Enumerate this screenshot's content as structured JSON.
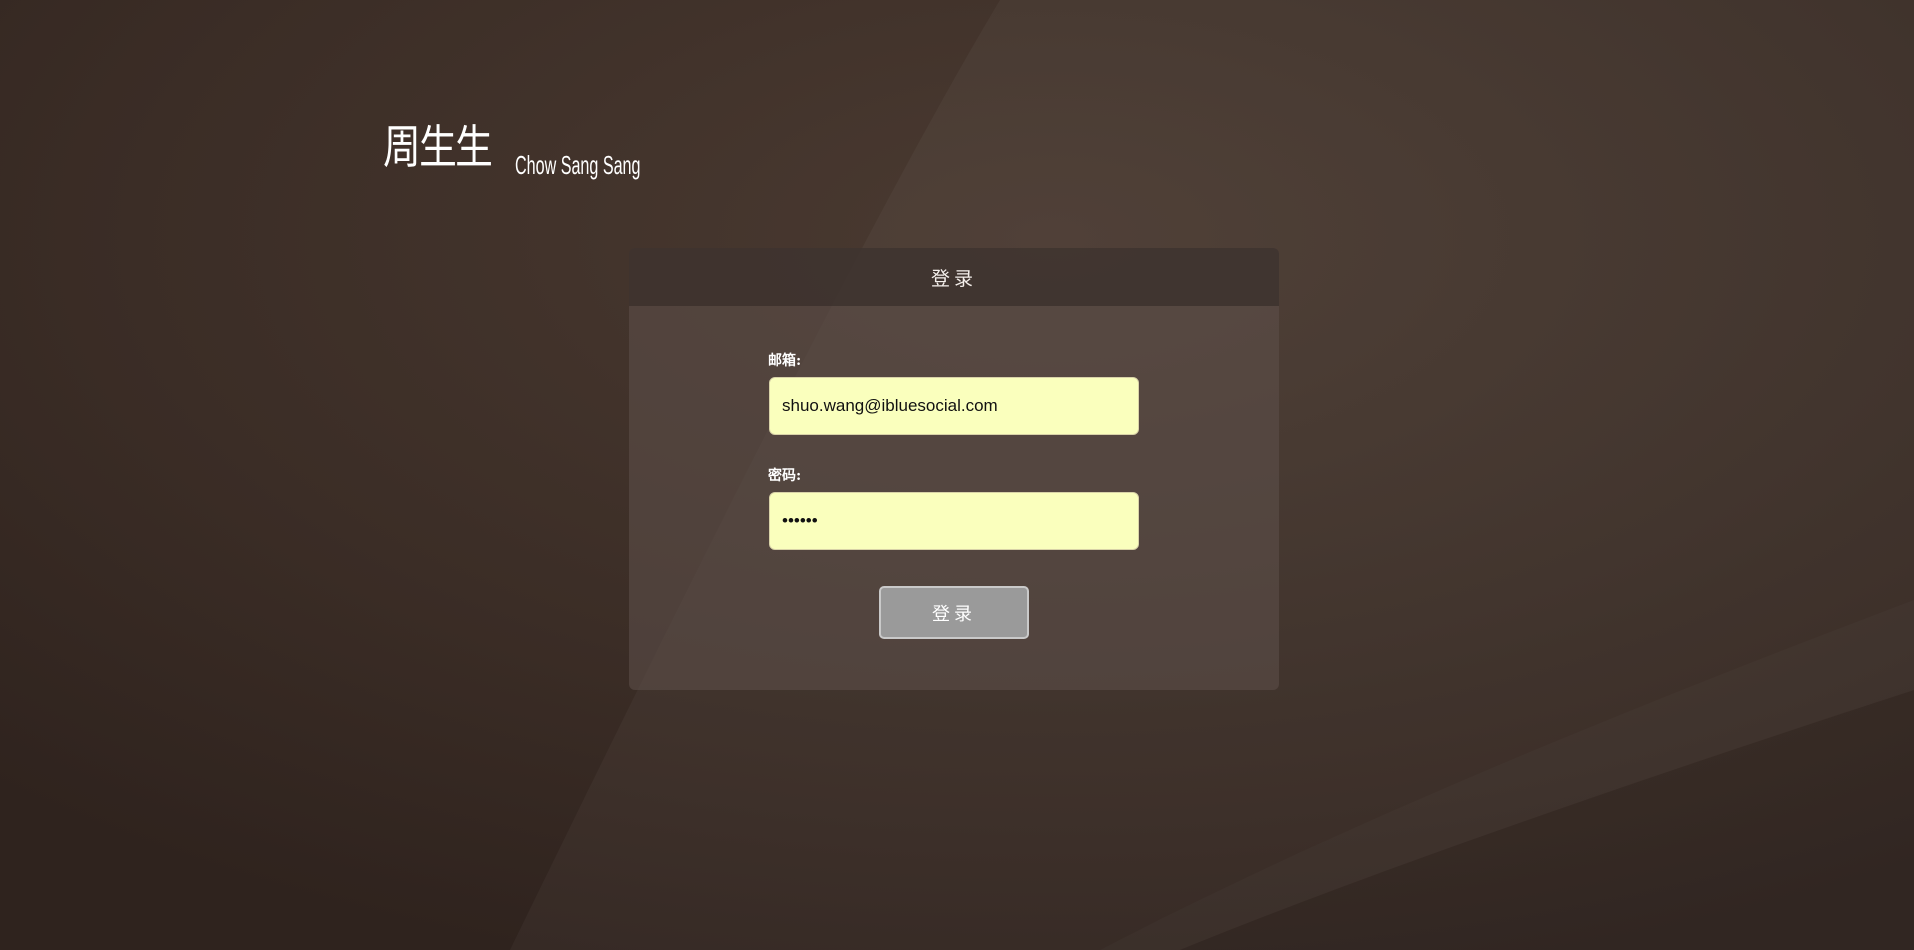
{
  "brand": {
    "name_cn": "周生生",
    "name_en": "Chow Sang Sang"
  },
  "login": {
    "title": "登录",
    "email_label": "邮箱:",
    "email_value": "shuo.wang@ibluesocial.com",
    "password_label": "密码:",
    "password_value": "••••••",
    "submit_label": "登录"
  },
  "colors": {
    "background": "#3a2c25",
    "input_background": "#faffbd",
    "button_background": "#9a9a9a"
  }
}
